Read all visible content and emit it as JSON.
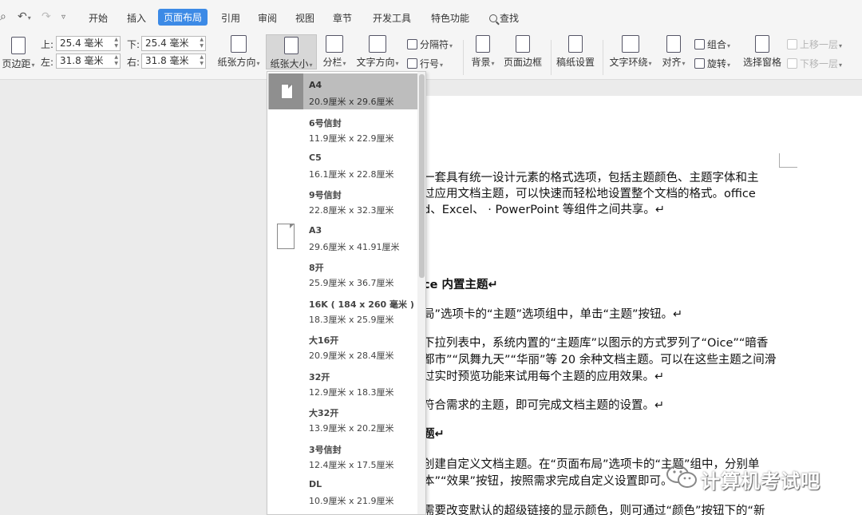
{
  "quick_access": {
    "icons": [
      "print-preview-icon",
      "undo-icon",
      "redo-icon",
      "customize-icon"
    ]
  },
  "menu_tabs": [
    "开始",
    "插入",
    "页面布局",
    "引用",
    "审阅",
    "视图",
    "章节",
    "开发工具",
    "特色功能"
  ],
  "search_tab": "查找",
  "ribbon": {
    "margins_label": "页边距",
    "top_label": "上:",
    "top_value": "25.4 毫米",
    "bottom_label": "下:",
    "bottom_value": "25.4 毫米",
    "left_label": "左:",
    "left_value": "31.8 毫米",
    "right_label": "右:",
    "right_value": "31.8 毫米",
    "orientation": "纸张方向",
    "size": "纸张大小",
    "columns": "分栏",
    "text_direction": "文字方向",
    "separator": "分隔符",
    "line_numbers": "行号",
    "background": "背景",
    "page_border": "页面边框",
    "manuscript": "稿纸设置",
    "text_wrap": "文字环绕",
    "align": "对齐",
    "group": "组合",
    "rotate": "旋转",
    "selection_pane": "选择窗格",
    "bring_forward": "上移一层",
    "send_backward": "下移一层"
  },
  "paper_sizes": [
    {
      "name": "A4",
      "dims": "20.9厘米  x  29.6厘米",
      "selected": true
    },
    {
      "name": "6号信封",
      "dims": "11.9厘米  x  22.9厘米"
    },
    {
      "name": "C5",
      "dims": "16.1厘米  x  22.8厘米"
    },
    {
      "name": "9号信封",
      "dims": "22.8厘米  x  32.3厘米"
    },
    {
      "name": "A3",
      "dims": "29.6厘米  x  41.91厘米"
    },
    {
      "name": "8开",
      "dims": "25.9厘米  x  36.7厘米"
    },
    {
      "name": "16K ( 184 x 260 毫米 )",
      "dims": "18.3厘米  x  25.9厘米"
    },
    {
      "name": "大16开",
      "dims": "20.9厘米  x  28.4厘米"
    },
    {
      "name": "32开",
      "dims": "12.9厘米  x  18.3厘米"
    },
    {
      "name": "大32开",
      "dims": "13.9厘米  x  20.2厘米"
    },
    {
      "name": "3号信封",
      "dims": "12.4厘米  x  17.5厘米"
    },
    {
      "name": "DL",
      "dims": "10.9厘米  x  21.9厘米"
    }
  ],
  "document_lines": [
    "一套具有统一设计元素的格式选项，包括主题颜色、主题字体和主",
    "过应用文档主题，可以快速而轻松地设置整个文档的格式。office",
    "d、Excel、 · PowerPoint 等组件之间共享。↵",
    "ce 内置主题↵",
    "局”选项卡的“主题”选项组中，单击“主题”按钮。↵",
    "下拉列表中，系统内置的“主题库”以图示的方式罗列了“Oice”“暗香",
    "都市”“凤舞九天”“华丽”等 20 余种文档主题。可以在这些主题之间滑",
    "过实时预览功能来试用每个主题的应用效果。↵",
    "符合需求的主题，即可完成文档主题的设置。↵",
    "题↵",
    "创建自定义文档主题。在“页面布局”选项卡的“主题”组中，分别单",
    "本”“效果”按钮，按照需求完成自定义设置即可。",
    "需要改变默认的超级链接的显示颜色，则可通过“颜色”按钮下的“新"
  ],
  "watermark": "计算机考试吧",
  "colors": {
    "active_tab": "#3c8ae6",
    "selected_item": "#bdbdbd"
  }
}
